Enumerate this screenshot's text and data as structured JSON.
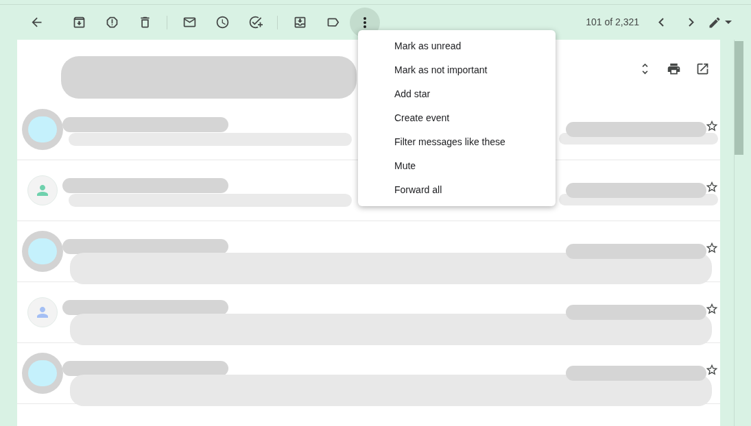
{
  "toolbar": {
    "more_menu_open": true,
    "counter": "101 of 2,321"
  },
  "menu": {
    "items": [
      {
        "label": "Mark as unread"
      },
      {
        "label": "Mark as not important"
      },
      {
        "label": "Add star"
      },
      {
        "label": "Create event"
      },
      {
        "label": "Filter messages like these"
      },
      {
        "label": "Mute"
      },
      {
        "label": "Forward all"
      }
    ]
  },
  "messages": [
    {
      "kind": "short",
      "avatar": {
        "kind": "photo"
      },
      "starred": false
    },
    {
      "kind": "short",
      "avatar": {
        "kind": "default",
        "color": "#6fd1ad"
      },
      "starred": false
    },
    {
      "kind": "long",
      "avatar": {
        "kind": "photo"
      },
      "starred": false
    },
    {
      "kind": "long",
      "avatar": {
        "kind": "default",
        "color": "#a4bff4"
      },
      "starred": false
    },
    {
      "kind": "long",
      "avatar": {
        "kind": "photo"
      },
      "starred": false
    }
  ]
}
